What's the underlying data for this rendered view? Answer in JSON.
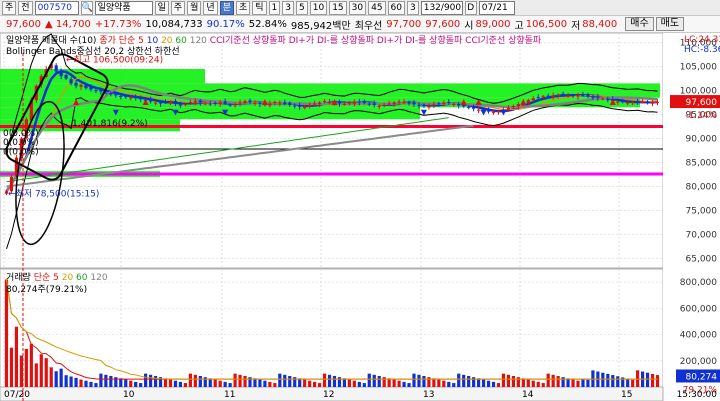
{
  "toolbar": {
    "buttons": [
      "주",
      "전"
    ],
    "code": "007570",
    "name": "일양약품",
    "periods": [
      "일",
      "주",
      "월",
      "년",
      "분",
      "초",
      "틱",
      "1",
      "3",
      "5",
      "10",
      "15",
      "30",
      "45",
      "60",
      "3"
    ],
    "active_period": "분",
    "count": "132/900",
    "d_label": "D",
    "date": "07/21"
  },
  "infobar": {
    "price": "97,600",
    "change": "▲ 14,700",
    "change_pct": "+17.73%",
    "volume": "10,084,733",
    "vol_ratio": "90.17%",
    "turnover": "52.84%",
    "amount": "985,942백만",
    "best_bid_label": "최우선",
    "best1": "97,700",
    "best2": "97,600",
    "open_label": "시",
    "open": "89,000",
    "high_label": "고",
    "high": "106,500",
    "low_label": "저",
    "low": "88,400",
    "buy": "매수",
    "sell": "매도"
  },
  "price_panel": {
    "legend1": [
      {
        "text": "일양약품 매물대 수(10)",
        "color": "#000000"
      },
      {
        "text": "종가 단순 5",
        "color": "#e01010"
      },
      {
        "text": "10",
        "color": "#1030d0"
      },
      {
        "text": "20",
        "color": "#d0a000"
      },
      {
        "text": "60",
        "color": "#20a020"
      },
      {
        "text": "120",
        "color": "#808080"
      },
      {
        "text": "CCI기준선 상향돌파",
        "color": "#c01080"
      },
      {
        "text": "DI+가 DI-를 상향돌파",
        "color": "#c01080"
      },
      {
        "text": "DI+가 DI-를 상향돌파",
        "color": "#c01080"
      },
      {
        "text": "CCI기준선 상향돌파",
        "color": "#c01080"
      }
    ],
    "legend2": [
      {
        "text": "Bollinger Bands중심선 20,2",
        "color": "#000000"
      },
      {
        "text": "상한선",
        "color": "#000000"
      },
      {
        "text": "하한선",
        "color": "#000000"
      }
    ],
    "y_ticks": [
      "110,000",
      "105,000",
      "100,000",
      "95,000",
      "90,000",
      "85,000",
      "80,000",
      "75,000",
      "70,000",
      "65,000"
    ],
    "top_right": [
      "LC:24.33",
      "HC:-8.36"
    ],
    "price_tag": "97,600",
    "price_tag_pct": "-1.14%",
    "high_note": "최고 106,500(09:24)",
    "low_note": "최저 78,500(15:15)",
    "vp_label_1": "1,401,816(9.2%)",
    "vp_label_2": "0(0.0%)",
    "vp_label_3": "0(0.0%)",
    "vp_label_4": "0(0.0%)"
  },
  "volume_panel": {
    "legend": [
      {
        "text": "거래량",
        "color": "#000000"
      },
      {
        "text": "단순 5",
        "color": "#e01010"
      },
      {
        "text": "20",
        "color": "#d0a000"
      },
      {
        "text": "60",
        "color": "#20a020"
      },
      {
        "text": "120",
        "color": "#808080"
      }
    ],
    "value_note": "80,274주(79.21%)",
    "y_ticks": [
      "800,000",
      "600,000",
      "400,000",
      "200,000"
    ],
    "tag": "80,274",
    "tag_pct": "79.21%"
  },
  "x_axis": {
    "labels": [
      "07/20",
      "10",
      "11",
      "12",
      "13",
      "14",
      "15"
    ],
    "right_label": "15:30:00"
  },
  "colors": {
    "up": "#e01010",
    "down": "#1030d0",
    "vp_band": "#00ee00",
    "support_line": "#ff0030",
    "magenta_line": "#ff00ff"
  },
  "chart_data": {
    "type": "candlestick",
    "price_axis": {
      "ylim": [
        63000,
        112000
      ],
      "ticks": [
        65000,
        70000,
        75000,
        80000,
        85000,
        90000,
        95000,
        100000,
        105000,
        110000
      ]
    },
    "volume_axis": {
      "ylim": [
        0,
        900000
      ],
      "ticks": [
        200000,
        400000,
        600000,
        800000
      ]
    },
    "horizontal_lines": [
      {
        "name": "red",
        "value": 92500,
        "color": "#ff0030"
      },
      {
        "name": "black",
        "value": 87800,
        "color": "#000000"
      },
      {
        "name": "magenta",
        "value": 82600,
        "color": "#ff00ff"
      }
    ],
    "close_path": [
      79000,
      82000,
      86000,
      90000,
      94000,
      98000,
      101000,
      103000,
      104500,
      105500,
      104000,
      103000,
      102500,
      101500,
      101000,
      101200,
      100500,
      100200,
      100000,
      99800,
      99500,
      99200,
      99000,
      98800,
      98600,
      98600,
      98400,
      98200,
      98000,
      97700,
      97500,
      97300,
      97500,
      97700,
      97300,
      97000,
      97200,
      97600,
      97800,
      97500,
      97300,
      97200,
      97400,
      97600,
      97300,
      97000,
      97100,
      97500,
      97800,
      97600,
      97400,
      97200,
      97000,
      97300,
      97600,
      97500,
      97200,
      97000,
      96800,
      96600,
      96700,
      97000,
      97300,
      97500,
      97800,
      97600,
      97400,
      97300,
      97200,
      97500,
      97700,
      97600,
      97400,
      97200,
      97000,
      96800,
      97000,
      97300,
      97500,
      97700,
      97600,
      97300,
      97100,
      96900,
      96700,
      96900,
      97100,
      97300,
      97500,
      97400,
      97200,
      96900,
      96700,
      96500,
      96200,
      96000,
      95800,
      95600,
      95500,
      95700,
      96000,
      96400,
      96800,
      97200,
      97600,
      98000,
      98400,
      98600,
      98800,
      98900,
      99000,
      99100,
      99000,
      98900,
      99000,
      99100,
      99000,
      98800,
      98600,
      98500,
      98300,
      98000,
      97800,
      97700,
      97600,
      97500,
      97600,
      97700,
      97600,
      97500,
      97600,
      97600
    ],
    "volume_sample": [
      820000,
      300000,
      460000,
      240000,
      290000,
      330000,
      180000,
      250000,
      220000,
      150000,
      120000,
      140000,
      90000,
      80000,
      70000
    ]
  }
}
